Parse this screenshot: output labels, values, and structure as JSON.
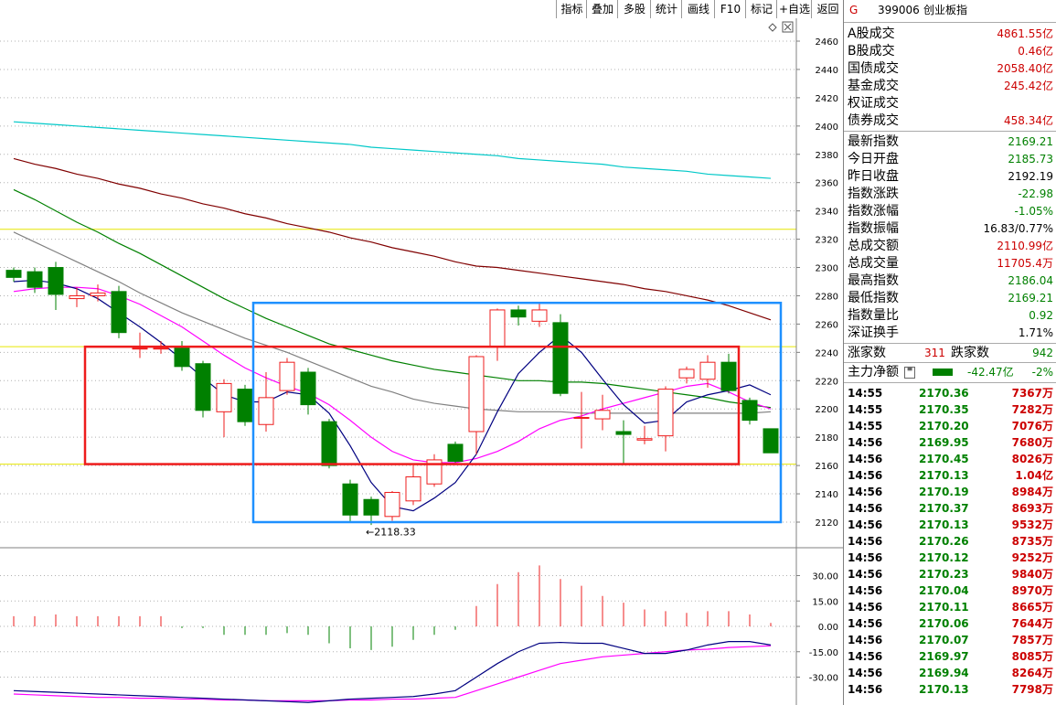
{
  "toolbar": {
    "buttons": [
      "指标",
      "叠加",
      "多股",
      "统计",
      "画线",
      "F10",
      "标记",
      "+自选",
      "返回"
    ]
  },
  "chart_data": [
    {
      "type": "candlestick",
      "title": "",
      "yticks": [
        2460,
        2440,
        2420,
        2400,
        2380,
        2360,
        2340,
        2320,
        2300,
        2280,
        2260,
        2240,
        2220,
        2200,
        2180,
        2160,
        2140,
        2120
      ],
      "ylim": [
        2120,
        2460
      ],
      "candles": [
        {
          "o": 2298,
          "c": 2293,
          "h": 2300,
          "l": 2290
        },
        {
          "o": 2297,
          "c": 2286,
          "h": 2300,
          "l": 2282
        },
        {
          "o": 2300,
          "c": 2281,
          "h": 2304,
          "l": 2270
        },
        {
          "o": 2278,
          "c": 2280,
          "h": 2286,
          "l": 2272
        },
        {
          "o": 2280,
          "c": 2282,
          "h": 2288,
          "l": 2276
        },
        {
          "o": 2283,
          "c": 2254,
          "h": 2287,
          "l": 2250
        },
        {
          "o": 2243,
          "c": 2243,
          "h": 2254,
          "l": 2236
        },
        {
          "o": 2243,
          "c": 2243,
          "h": 2248,
          "l": 2239
        },
        {
          "o": 2243,
          "c": 2230,
          "h": 2248,
          "l": 2227
        },
        {
          "o": 2232,
          "c": 2199,
          "h": 2234,
          "l": 2194
        },
        {
          "o": 2198,
          "c": 2218,
          "h": 2221,
          "l": 2180
        },
        {
          "o": 2214,
          "c": 2191,
          "h": 2217,
          "l": 2188
        },
        {
          "o": 2189,
          "c": 2208,
          "h": 2226,
          "l": 2184
        },
        {
          "o": 2213,
          "c": 2233,
          "h": 2236,
          "l": 2210
        },
        {
          "o": 2226,
          "c": 2203,
          "h": 2229,
          "l": 2196
        },
        {
          "o": 2191,
          "c": 2160,
          "h": 2193,
          "l": 2158
        },
        {
          "o": 2147,
          "c": 2125,
          "h": 2150,
          "l": 2120
        },
        {
          "o": 2136,
          "c": 2125,
          "h": 2138,
          "l": 2118
        },
        {
          "o": 2124,
          "c": 2141,
          "h": 2142,
          "l": 2121
        },
        {
          "o": 2135,
          "c": 2152,
          "h": 2160,
          "l": 2132
        },
        {
          "o": 2147,
          "c": 2164,
          "h": 2168,
          "l": 2145
        },
        {
          "o": 2175,
          "c": 2163,
          "h": 2177,
          "l": 2162
        },
        {
          "o": 2184,
          "c": 2237,
          "h": 2238,
          "l": 2168
        },
        {
          "o": 2244,
          "c": 2270,
          "h": 2271,
          "l": 2234
        },
        {
          "o": 2270,
          "c": 2265,
          "h": 2273,
          "l": 2259
        },
        {
          "o": 2262,
          "c": 2270,
          "h": 2275,
          "l": 2258
        },
        {
          "o": 2261,
          "c": 2211,
          "h": 2267,
          "l": 2209
        },
        {
          "o": 2194,
          "c": 2194,
          "h": 2212,
          "l": 2172
        },
        {
          "o": 2193,
          "c": 2199,
          "h": 2210,
          "l": 2185
        },
        {
          "o": 2184,
          "c": 2182,
          "h": 2192,
          "l": 2161
        },
        {
          "o": 2178,
          "c": 2179,
          "h": 2188,
          "l": 2175
        },
        {
          "o": 2181,
          "c": 2214,
          "h": 2216,
          "l": 2170
        },
        {
          "o": 2222,
          "c": 2228,
          "h": 2230,
          "l": 2218
        },
        {
          "o": 2221,
          "c": 2233,
          "h": 2238,
          "l": 2215
        },
        {
          "o": 2233,
          "c": 2213,
          "h": 2239,
          "l": 2211
        },
        {
          "o": 2206,
          "c": 2192,
          "h": 2208,
          "l": 2189
        },
        {
          "o": 2186,
          "c": 2169,
          "h": 2186,
          "l": 2169
        }
      ],
      "ma_lines": [
        {
          "color": "#00c8c8",
          "values": [
            2403,
            2402,
            2401,
            2400,
            2399,
            2398,
            2397,
            2396,
            2395,
            2394,
            2393,
            2392,
            2391,
            2390,
            2389,
            2388,
            2387,
            2385,
            2384,
            2383,
            2382,
            2381,
            2380,
            2379,
            2377,
            2376,
            2375,
            2374,
            2373,
            2371,
            2370,
            2369,
            2368,
            2366,
            2365,
            2364,
            2363
          ]
        },
        {
          "color": "#800000",
          "values": [
            2377,
            2373,
            2370,
            2366,
            2363,
            2359,
            2356,
            2352,
            2349,
            2345,
            2342,
            2338,
            2335,
            2331,
            2328,
            2325,
            2321,
            2318,
            2314,
            2311,
            2308,
            2304,
            2301,
            2300,
            2298,
            2296,
            2294,
            2292,
            2290,
            2288,
            2285,
            2283,
            2280,
            2277,
            2273,
            2268,
            2263
          ]
        },
        {
          "color": "#008000",
          "values": [
            2355,
            2348,
            2340,
            2332,
            2325,
            2317,
            2310,
            2302,
            2294,
            2286,
            2278,
            2271,
            2264,
            2258,
            2252,
            2246,
            2242,
            2238,
            2234,
            2231,
            2228,
            2226,
            2224,
            2222,
            2220,
            2220,
            2219,
            2219,
            2218,
            2216,
            2214,
            2212,
            2210,
            2208,
            2205,
            2203,
            2201
          ]
        },
        {
          "color": "#808080",
          "values": [
            2325,
            2318,
            2311,
            2304,
            2297,
            2290,
            2282,
            2275,
            2268,
            2262,
            2256,
            2250,
            2245,
            2240,
            2234,
            2228,
            2222,
            2216,
            2212,
            2207,
            2204,
            2202,
            2200,
            2199,
            2198,
            2198,
            2198,
            2197,
            2197,
            2197,
            2197,
            2197,
            2197,
            2197,
            2197,
            2197,
            2198
          ]
        },
        {
          "color": "#ff00ff",
          "values": [
            2283,
            2285,
            2286,
            2286,
            2285,
            2280,
            2274,
            2266,
            2258,
            2248,
            2238,
            2229,
            2222,
            2216,
            2211,
            2203,
            2192,
            2180,
            2170,
            2164,
            2162,
            2162,
            2165,
            2170,
            2177,
            2186,
            2192,
            2195,
            2200,
            2204,
            2208,
            2212,
            2216,
            2218,
            2212,
            2205,
            2200
          ]
        },
        {
          "color": "#000080",
          "values": [
            2290,
            2291,
            2289,
            2285,
            2278,
            2268,
            2258,
            2247,
            2235,
            2222,
            2210,
            2205,
            2205,
            2212,
            2210,
            2197,
            2174,
            2148,
            2131,
            2128,
            2137,
            2148,
            2168,
            2198,
            2225,
            2240,
            2252,
            2240,
            2221,
            2203,
            2190,
            2192,
            2205,
            2210,
            2213,
            2217,
            2210
          ]
        }
      ],
      "hlines": [
        {
          "value": 2327,
          "color": "#e6e600"
        },
        {
          "value": 2244,
          "color": "#e6e600"
        },
        {
          "value": 2161,
          "color": "#e6e600"
        }
      ],
      "annotations": [
        {
          "text": "←2118.33",
          "value": 2118.33,
          "index": 17
        }
      ],
      "rectangles": [
        {
          "color": "#ee1c1c",
          "x_from": 4,
          "x_to": 34,
          "y_from": 2244,
          "y_to": 2161
        },
        {
          "color": "#1e90ff",
          "x_from": 12,
          "x_to": 36,
          "y_from": 2275,
          "y_to": 2120
        }
      ]
    },
    {
      "type": "bar",
      "title": "",
      "yticks": [
        30.0,
        15.0,
        0.0,
        -15.0,
        -30.0
      ],
      "ylim": [
        -45,
        45
      ],
      "values": [
        6,
        6,
        7,
        6,
        6,
        6,
        6,
        6,
        -1,
        -1,
        -5,
        -5,
        -5,
        -4,
        -5,
        -10,
        -13,
        -14,
        -12,
        -8,
        -5,
        -2,
        12,
        25,
        32,
        36,
        28,
        24,
        18,
        14,
        10,
        9,
        8,
        9,
        9,
        7,
        2
      ],
      "dif": [
        -38,
        -38.5,
        -39,
        -39.5,
        -40,
        -40.5,
        -41,
        -41.5,
        -42,
        -42.5,
        -43,
        -43.5,
        -44,
        -44.5,
        -45,
        -44,
        -43,
        -42.5,
        -42,
        -41.5,
        -40,
        -38,
        -30,
        -22,
        -15,
        -10,
        -9.5,
        -10,
        -10,
        -13,
        -16,
        -16,
        -14,
        -11,
        -9,
        -9,
        -11
      ],
      "dea": [
        -40,
        -40.5,
        -41,
        -41.5,
        -42,
        -42,
        -42.5,
        -42.5,
        -43,
        -43,
        -43.5,
        -43.5,
        -44,
        -44,
        -44,
        -44,
        -43.5,
        -43.5,
        -43,
        -43,
        -42.5,
        -42,
        -38,
        -34,
        -30,
        -26,
        -22,
        -20,
        -18,
        -17,
        -16,
        -15,
        -14,
        -13.5,
        -12.5,
        -12,
        -11.5
      ]
    }
  ],
  "panel": {
    "code": "399006",
    "name": "创业板指",
    "g": "G",
    "turnover": [
      {
        "k": "A股成交",
        "v": "4861.55亿"
      },
      {
        "k": "B股成交",
        "v": "0.46亿"
      },
      {
        "k": "国债成交",
        "v": "2058.40亿"
      },
      {
        "k": "基金成交",
        "v": "245.42亿"
      },
      {
        "k": "权证成交",
        "v": ""
      },
      {
        "k": "债券成交",
        "v": "458.34亿"
      }
    ],
    "stats": [
      {
        "k": "最新指数",
        "v": "2169.21",
        "c": "#008000"
      },
      {
        "k": "今日开盘",
        "v": "2185.73",
        "c": "#008000"
      },
      {
        "k": "昨日收盘",
        "v": "2192.19",
        "c": "#000000"
      },
      {
        "k": "指数涨跌",
        "v": "-22.98",
        "c": "#008000"
      },
      {
        "k": "指数涨幅",
        "v": "-1.05%",
        "c": "#008000"
      },
      {
        "k": "指数振幅",
        "v": "16.83/0.77%",
        "c": "#000000"
      },
      {
        "k": "总成交额",
        "v": "2110.99亿",
        "c": "#cc0000"
      },
      {
        "k": "总成交量",
        "v": "11705.4万",
        "c": "#cc0000"
      },
      {
        "k": "最高指数",
        "v": "2186.04",
        "c": "#008000"
      },
      {
        "k": "最低指数",
        "v": "2169.21",
        "c": "#008000"
      },
      {
        "k": "指数量比",
        "v": "0.92",
        "c": "#008000"
      },
      {
        "k": "深证换手",
        "v": "1.71%",
        "c": "#000000"
      }
    ],
    "up_label": "涨家数",
    "up_count": "311",
    "down_label": "跌家数",
    "down_count": "942",
    "flow_label": "主力净额",
    "flow_value": "-42.47亿",
    "flow_pct": "-2%",
    "ticks": [
      {
        "t": "14:55",
        "p": "2170.36",
        "q": "7367万"
      },
      {
        "t": "14:55",
        "p": "2170.35",
        "q": "7282万"
      },
      {
        "t": "14:55",
        "p": "2170.20",
        "q": "7076万"
      },
      {
        "t": "14:56",
        "p": "2169.95",
        "q": "7680万"
      },
      {
        "t": "14:56",
        "p": "2170.45",
        "q": "8026万"
      },
      {
        "t": "14:56",
        "p": "2170.13",
        "q": "1.04亿"
      },
      {
        "t": "14:56",
        "p": "2170.19",
        "q": "8984万"
      },
      {
        "t": "14:56",
        "p": "2170.37",
        "q": "8693万"
      },
      {
        "t": "14:56",
        "p": "2170.13",
        "q": "9532万"
      },
      {
        "t": "14:56",
        "p": "2170.26",
        "q": "8735万"
      },
      {
        "t": "14:56",
        "p": "2170.12",
        "q": "9252万"
      },
      {
        "t": "14:56",
        "p": "2170.23",
        "q": "9840万"
      },
      {
        "t": "14:56",
        "p": "2170.04",
        "q": "8970万"
      },
      {
        "t": "14:56",
        "p": "2170.11",
        "q": "8665万"
      },
      {
        "t": "14:56",
        "p": "2170.06",
        "q": "7644万"
      },
      {
        "t": "14:56",
        "p": "2170.07",
        "q": "7857万"
      },
      {
        "t": "14:56",
        "p": "2169.97",
        "q": "8085万"
      },
      {
        "t": "14:56",
        "p": "2169.94",
        "q": "8264万"
      },
      {
        "t": "14:56",
        "p": "2170.13",
        "q": "7798万"
      }
    ]
  }
}
